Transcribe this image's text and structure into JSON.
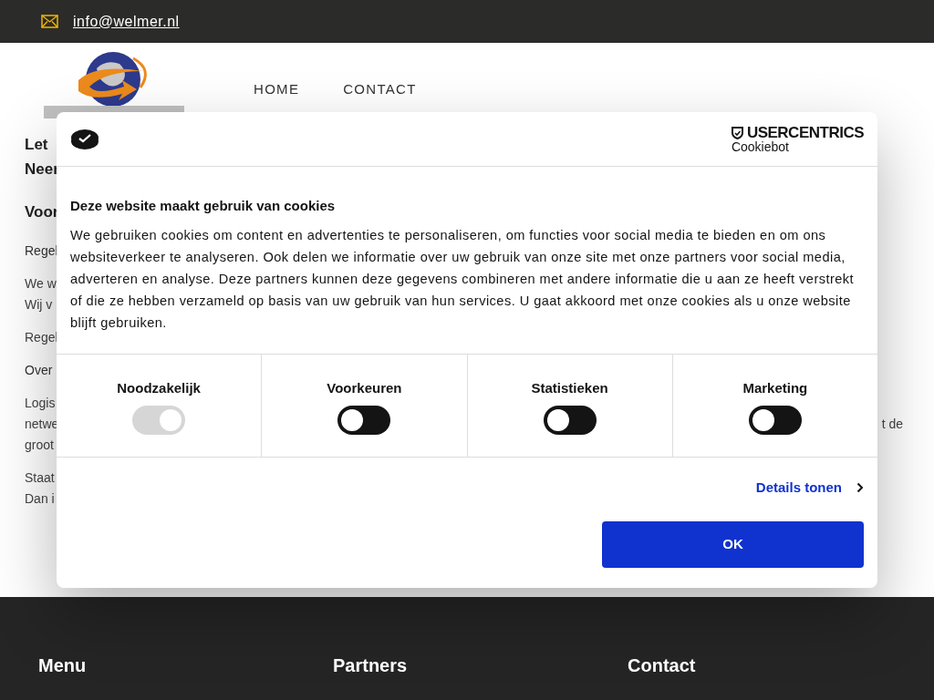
{
  "top_bar": {
    "email": "info@welmer.nl"
  },
  "nav": {
    "items": [
      {
        "label": "HOME"
      },
      {
        "label": "CONTACT"
      }
    ]
  },
  "page": {
    "paragraphs": [
      {
        "kind": "heading",
        "lines": [
          {
            "text": "Let"
          },
          {
            "text": "Neer"
          }
        ]
      },
      {
        "kind": "subheading",
        "lines": [
          {
            "text": "Voor"
          }
        ]
      },
      {
        "kind": "label",
        "lines": [
          {
            "text": "Regel"
          }
        ]
      },
      {
        "kind": "body",
        "lines": [
          {
            "text": "We w"
          },
          {
            "text": "Wij v"
          }
        ]
      },
      {
        "kind": "body",
        "lines": [
          {
            "text": "Regel"
          }
        ]
      },
      {
        "kind": "label",
        "lines": [
          {
            "text": "Over"
          }
        ]
      },
      {
        "kind": "body",
        "lines": [
          {
            "text": "Logis"
          },
          {
            "text": "netwe",
            "right": "t de"
          },
          {
            "text": "groot"
          }
        ]
      },
      {
        "kind": "body",
        "lines": [
          {
            "text": "Staat"
          },
          {
            "text": "Dan i"
          }
        ]
      }
    ]
  },
  "cookie_dialog": {
    "brand": "USERCENTRICS",
    "brand_sub": "Cookiebot",
    "title": "Deze website maakt gebruik van cookies",
    "body": "We gebruiken cookies om content en advertenties te personaliseren, om functies voor social media te bieden en om ons websiteverkeer te analyseren. Ook delen we informatie over uw gebruik van onze site met onze partners voor social media, adverteren en analyse. Deze partners kunnen deze gegevens combineren met andere informatie die u aan ze heeft verstrekt of die ze hebben verzameld op basis van uw gebruik van hun services. U gaat akkoord met onze cookies als u onze website blijft gebruiken.",
    "categories": [
      {
        "label": "Noodzakelijk",
        "checked": true,
        "disabled": true
      },
      {
        "label": "Voorkeuren",
        "checked": false,
        "disabled": false
      },
      {
        "label": "Statistieken",
        "checked": false,
        "disabled": false
      },
      {
        "label": "Marketing",
        "checked": false,
        "disabled": false
      }
    ],
    "details_link": "Details tonen",
    "ok_button": "OK"
  },
  "footer": {
    "headings": [
      "Menu",
      "Partners",
      "Contact"
    ]
  }
}
